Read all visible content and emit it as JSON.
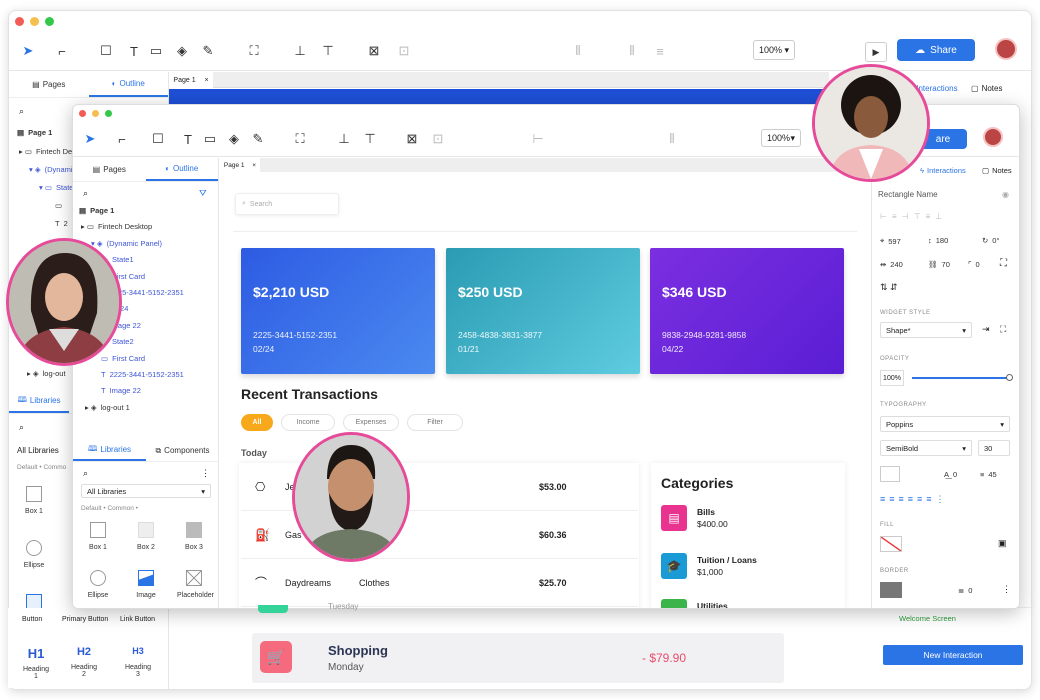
{
  "back": {
    "zoom": "100%",
    "share_label": "Share",
    "tab_pages": "Pages",
    "tab_outline": "Outline",
    "page_tab": "Page 1",
    "tab_interactions": "Interactions",
    "tab_notes": "Notes",
    "tree": [
      "Page 1",
      "Fintech De",
      "(Dynami",
      "State",
      "2"
    ],
    "tab_libraries": "Libraries",
    "all_libraries": "All Libraries",
    "default_common": "Default • Commo",
    "lib_items": [
      "Box 1",
      "Ellipse"
    ],
    "widgets": [
      "Button",
      "Primary Button",
      "Link Button"
    ],
    "headings": [
      {
        "glyph": "H1",
        "label": "Heading 1"
      },
      {
        "glyph": "H2",
        "label": "Heading 2"
      },
      {
        "glyph": "H3",
        "label": "Heading 3"
      }
    ],
    "logout": "log-out",
    "welcome": "Welcome Screen",
    "new_interaction": "New Interaction"
  },
  "front": {
    "zoom": "100%",
    "share_label": "are",
    "page_tab": "Page 1",
    "tab_pages": "Pages",
    "tab_outline": "Outline",
    "tab_interactions": "Interactions",
    "tab_notes": "Notes",
    "tree": [
      {
        "t": "Page 1",
        "c": "dark"
      },
      {
        "t": "Fintech Desktop",
        "c": "dark"
      },
      {
        "t": "(Dynamic Panel)",
        "c": "blue"
      },
      {
        "t": "State1",
        "c": "blue"
      },
      {
        "t": "First Card",
        "c": "blue"
      },
      {
        "t": "2225-3441-5152-2351",
        "c": "blue"
      },
      {
        "t": "02/24",
        "c": "blue"
      },
      {
        "t": "Image 22",
        "c": "blue"
      },
      {
        "t": "State2",
        "c": "blue"
      },
      {
        "t": "First Card",
        "c": "blue"
      },
      {
        "t": "2225-3441-5152-2351",
        "c": "blue"
      },
      {
        "t": "Image 22",
        "c": "blue"
      },
      {
        "t": "log-out 1",
        "c": "dark"
      }
    ],
    "tab_libraries": "Libraries",
    "tab_components": "Components",
    "all_libraries": "All Libraries",
    "default_common": "Default • Common •",
    "lib_items": [
      "Box 1",
      "Box 2",
      "Box 3",
      "Ellipse",
      "Image",
      "Placeholder"
    ],
    "search_placeholder": "Search",
    "cards": [
      {
        "amount": "$2,210 USD",
        "number": "2225-3441-5152-2351",
        "exp": "02/24",
        "c1": "#2d5be3",
        "c2": "#4b8af0"
      },
      {
        "amount": "$250 USD",
        "number": "2458-4838-3831-3877",
        "exp": "01/21",
        "c1": "#2a9bb3",
        "c2": "#5fcce0"
      },
      {
        "amount": "$346 USD",
        "number": "9838-2948-9281-9858",
        "exp": "04/22",
        "c1": "#7b2fe0",
        "c2": "#5a1ed4"
      }
    ],
    "recent_title": "Recent Transactions",
    "filters": [
      "All",
      "Income",
      "Expenses",
      "Filter"
    ],
    "today": "Today",
    "transactions": [
      {
        "name": "Je",
        "cat": "ase",
        "amount": "$53.00",
        "icon": "bag-icon"
      },
      {
        "name": "Gas",
        "cat": "",
        "amount": "$60.36",
        "icon": "fuel-icon"
      },
      {
        "name": "Daydreams",
        "cat": "Clothes",
        "amount": "$25.70",
        "icon": "hanger-icon"
      }
    ],
    "categories_title": "Categories",
    "categories": [
      {
        "name": "Bills",
        "value": "$400.00",
        "color": "#e8338f"
      },
      {
        "name": "Tuition / Loans",
        "value": "$1,000",
        "color": "#1a9bd6"
      },
      {
        "name": "Utilities",
        "value": "",
        "color": "#3bb54a"
      }
    ],
    "props": {
      "rect_name": "Rectangle Name",
      "x": "597",
      "r": "180",
      "rot": "0°",
      "w": "240",
      "h": "70",
      "corner": "0",
      "widget_style_label": "WIDGET STYLE",
      "widget_style": "Shape*",
      "opacity_label": "OPACITY",
      "opacity": "100%",
      "typography_label": "TYPOGRAPHY",
      "font": "Poppins",
      "weight": "SemiBold",
      "size": "30",
      "letter": "0",
      "line": "45",
      "fill_label": "FILL",
      "border_label": "BORDER",
      "border_w": "0"
    }
  },
  "bottom": {
    "shopping": "Shopping",
    "day": "Monday",
    "amount": "- $79.90",
    "partial": "Tuesday"
  }
}
